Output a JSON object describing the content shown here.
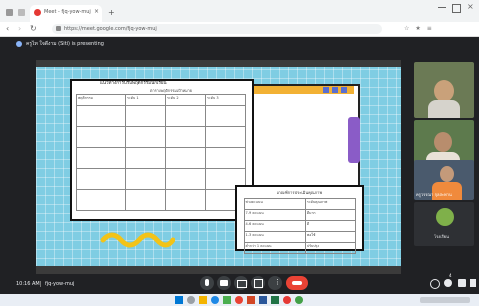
{
  "browser": {
    "tab_title": "Meet - fjq-yow-muj",
    "url": "https://meet.google.com/fjq-yow-muj"
  },
  "meet": {
    "presenting_banner": "ครูไท ใจดีงาม (Siti) is presenting",
    "time": "10:16 AM",
    "meeting_code": "fjq-yow-muj",
    "participant_count": "4",
    "participants": [
      {
        "name": ""
      },
      {
        "name": ""
      },
      {
        "name": "ครูวรรณา กุลสะพาน"
      },
      {
        "name": "โรงเรียน"
      }
    ]
  },
  "slide": {
    "doc_title": "แนวทางการปรับพฤติกรรมนักเรียน",
    "doc_subtitle": "ตารางพฤติกรรมเป้าหมาย",
    "table_headers": [
      "พฤติกรรม",
      "ระดับ 1",
      "ระดับ 2",
      "ระดับ 3"
    ],
    "table2_title": "เกณฑ์การประเมินคุณภาพ",
    "table2_headers": [
      "ช่วงคะแนน",
      "ระดับคุณภาพ"
    ],
    "table2_rows": [
      [
        "7-9 คะแนน",
        "ดีมาก"
      ],
      [
        "4-6 คะแนน",
        "ดี"
      ],
      [
        "1-3 คะแนน",
        "พอใช้"
      ],
      [
        "ต่ำกว่า 1 คะแนน",
        "ปรับปรุง"
      ]
    ]
  }
}
